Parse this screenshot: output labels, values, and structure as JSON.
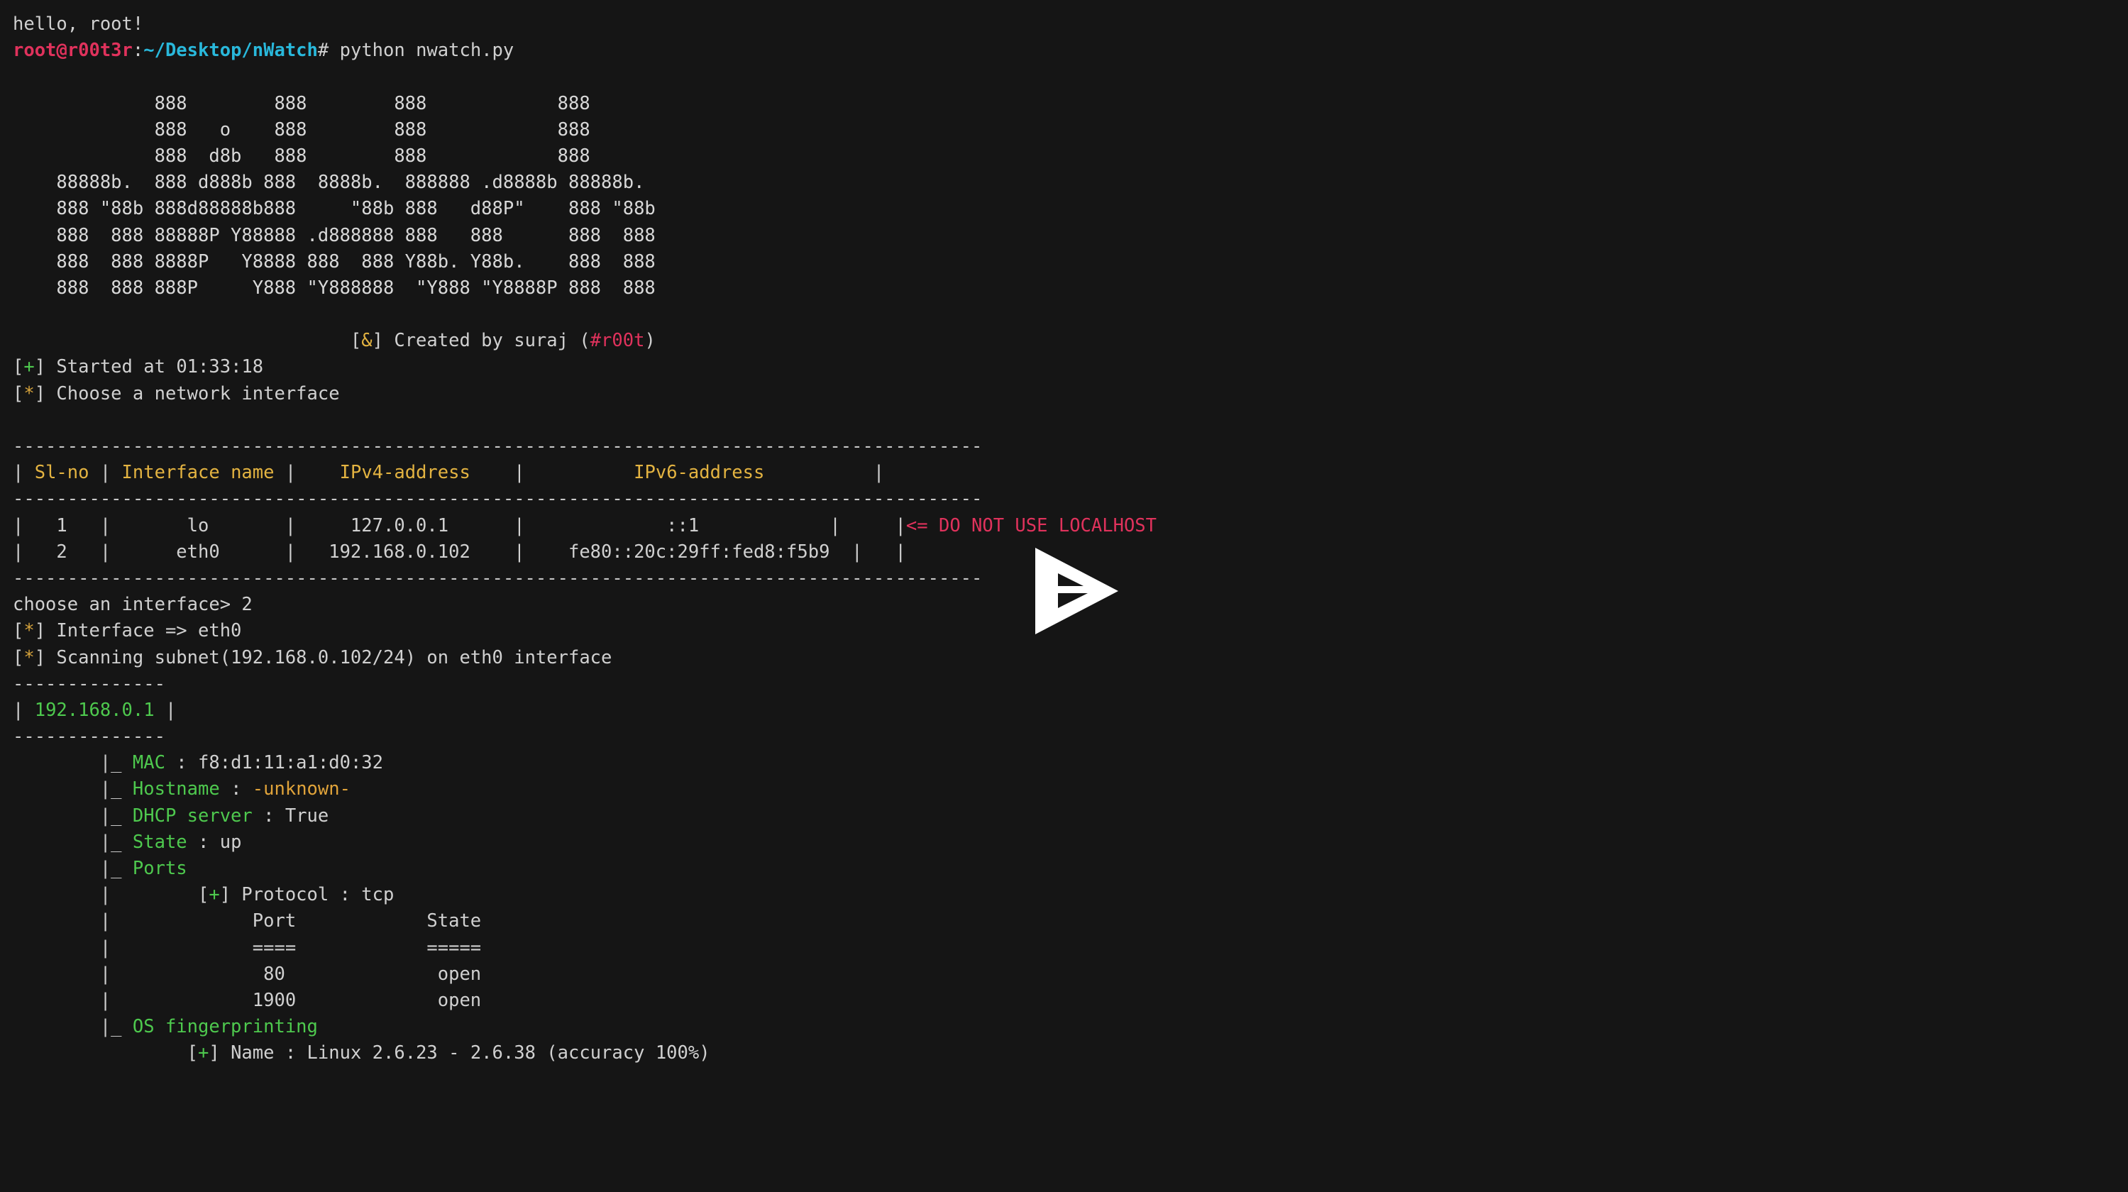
{
  "theme": {
    "background": "#151515",
    "foreground": "#d0d0d0",
    "green": "#4ec94e",
    "yellow": "#d7a43c",
    "orange": "#e0a33a",
    "pink": "#e0325c",
    "cyan": "#29b8db"
  },
  "greeting": "hello, root!",
  "prompt": {
    "user_host": "root@r00t3r",
    "colon": ":",
    "path": "~/Desktop/nWatch",
    "sigil": "# ",
    "command": "python nwatch.py"
  },
  "banner": {
    "lines": [
      "             888        888        888            888",
      "             888   o    888        888            888",
      "             888  d8b   888        888            888",
      "    88888b.  888 d888b 888  8888b.  888888 .d8888b 88888b.",
      "    888 \"88b 888d88888b888     \"88b 888   d88P\"    888 \"88b",
      "    888  888 88888P Y88888 .d888888 888   888      888  888",
      "    888  888 8888P   Y8888 888  888 Y88b. Y88b.    888  888",
      "    888  888 888P     Y888 \"Y888888  \"Y888 \"Y8888P 888  888"
    ],
    "credit_prefix": "[",
    "credit_symbol": "&",
    "credit_suffix": "] Created by suraj (",
    "credit_handle": "#r00t",
    "credit_close": ")"
  },
  "status": {
    "started_bracket_open": "[",
    "started_mark": "+",
    "started_bracket_close": "] Started at ",
    "started_time": "01:33:18",
    "choose_bracket_open": "[",
    "choose_mark": "*",
    "choose_bracket_close": "] Choose a network interface"
  },
  "interface_table": {
    "rule": "-----------------------------------------------------------------------------------------",
    "header": {
      "sl_no": "Sl-no",
      "interface_name": "Interface name",
      "ipv4": "IPv4-address",
      "ipv6": "IPv6-address"
    },
    "header_line": "| Sl-no | Interface name |    IPv4-address    |          IPv6-address          |",
    "rows": [
      {
        "line": "|   1   |       lo       |     127.0.0.1      |             ::1            |",
        "sl_no": "1",
        "name": "lo",
        "ipv4": "127.0.0.1",
        "ipv6": "::1",
        "warning": "<= DO NOT USE LOCALHOST"
      },
      {
        "line": "|   2   |      eth0      |   192.168.0.102    |    fe80::20c:29ff:fed8:f5b9  |",
        "sl_no": "2",
        "name": "eth0",
        "ipv4": "192.168.0.102",
        "ipv6": "fe80::20c:29ff:fed8:f5b9",
        "warning": ""
      }
    ]
  },
  "session": {
    "choose_prompt": "choose an interface> ",
    "choose_value": "2",
    "interface_line_open": "[",
    "interface_mark": "*",
    "interface_line_close": "] Interface => eth0",
    "scanning_open": "[",
    "scanning_mark": "*",
    "scanning_close": "] Scanning subnet(192.168.0.102/24) on eth0 interface"
  },
  "host": {
    "rule": "--------------",
    "ip_prefix": "| ",
    "ip": "192.168.0.1",
    "ip_suffix": " |",
    "fields": [
      {
        "branch": "|_ ",
        "label": "MAC",
        "sep": " : ",
        "value": "f8:d1:11:a1:d0:32",
        "value_color": "white"
      },
      {
        "branch": "|_ ",
        "label": "Hostname",
        "sep": " : ",
        "value": "-unknown-",
        "value_color": "orange"
      },
      {
        "branch": "|_ ",
        "label": "DHCP server",
        "sep": " : ",
        "value": "True",
        "value_color": "white"
      },
      {
        "branch": "|_ ",
        "label": "State",
        "sep": " : ",
        "value": "up",
        "value_color": "white"
      }
    ],
    "ports_branch": "|_ ",
    "ports_label": "Ports",
    "protocol_pipe": "|        ",
    "protocol_open": "[",
    "protocol_mark": "+",
    "protocol_close": "] Protocol : tcp",
    "ports_table": {
      "pipe": "|             ",
      "headers": {
        "port": "Port",
        "state": "State"
      },
      "header_line": "|             Port            State",
      "divider_line": "|             ====            =====",
      "rows": [
        {
          "line": "|              80              open",
          "port": "80",
          "state": "open"
        },
        {
          "line": "|             1900             open",
          "port": "1900",
          "state": "open"
        }
      ]
    },
    "os_branch": "|_ ",
    "os_label": "OS fingerprinting",
    "os_result_indent": "        ",
    "os_open": "[",
    "os_mark": "+",
    "os_close": "] Name : ",
    "os_name": "Linux 2.6.23 - 2.6.38 (accuracy 100%)"
  },
  "overlay": {
    "play_button_label": "play-recording"
  }
}
